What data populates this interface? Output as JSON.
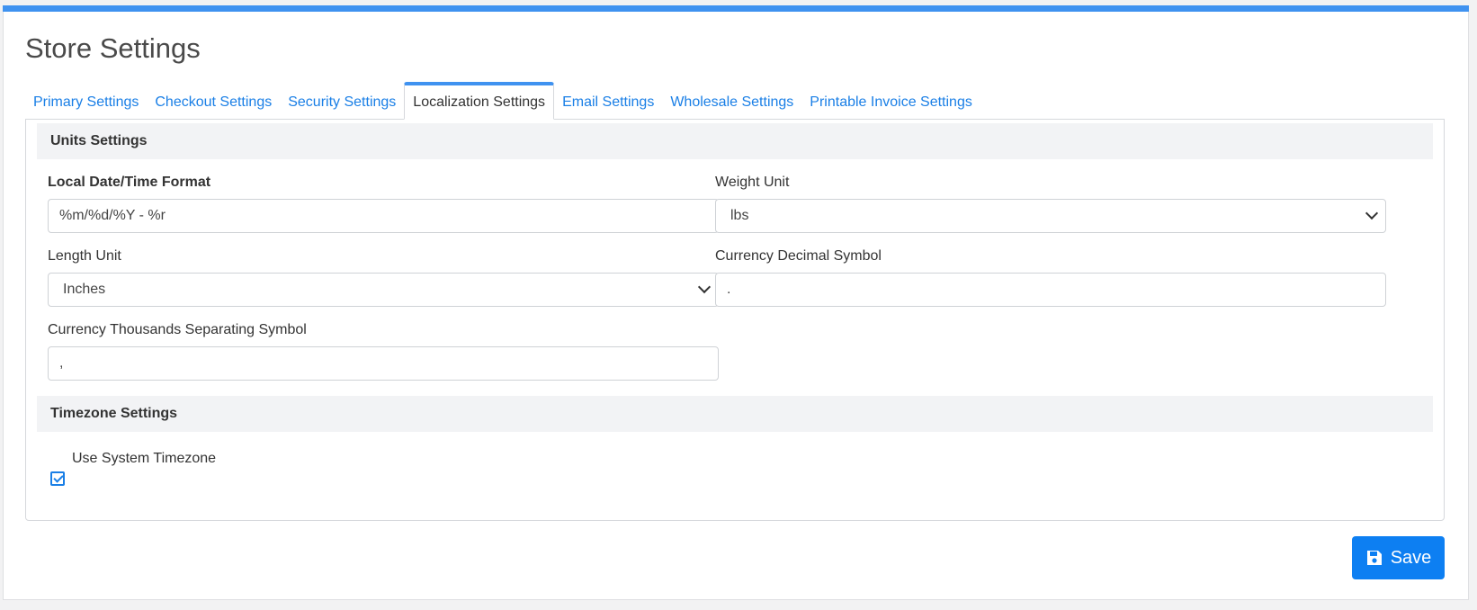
{
  "page": {
    "title": "Store Settings"
  },
  "tabs": [
    {
      "label": "Primary Settings",
      "active": false
    },
    {
      "label": "Checkout Settings",
      "active": false
    },
    {
      "label": "Security Settings",
      "active": false
    },
    {
      "label": "Localization Settings",
      "active": true
    },
    {
      "label": "Email Settings",
      "active": false
    },
    {
      "label": "Wholesale Settings",
      "active": false
    },
    {
      "label": "Printable Invoice Settings",
      "active": false
    }
  ],
  "units": {
    "header": "Units Settings",
    "date_format": {
      "label": "Local Date/Time Format",
      "value": "%m/%d/%Y - %r"
    },
    "weight_unit": {
      "label": "Weight Unit",
      "value": "lbs"
    },
    "length_unit": {
      "label": "Length Unit",
      "value": "Inches"
    },
    "decimal_symbol": {
      "label": "Currency Decimal Symbol",
      "value": "."
    },
    "thousands_symbol": {
      "label": "Currency Thousands Separating Symbol",
      "value": ","
    }
  },
  "timezone": {
    "header": "Timezone Settings",
    "use_system": {
      "label": "Use System Timezone",
      "checked": true
    }
  },
  "actions": {
    "save_label": "Save"
  },
  "colors": {
    "accent": "#3f92f0",
    "link": "#1a7fe6",
    "button": "#0d7ff2"
  },
  "icons": {
    "save": "floppy-disk-icon",
    "checkbox": "checkmark-icon",
    "select": "chevron-down-icon"
  }
}
